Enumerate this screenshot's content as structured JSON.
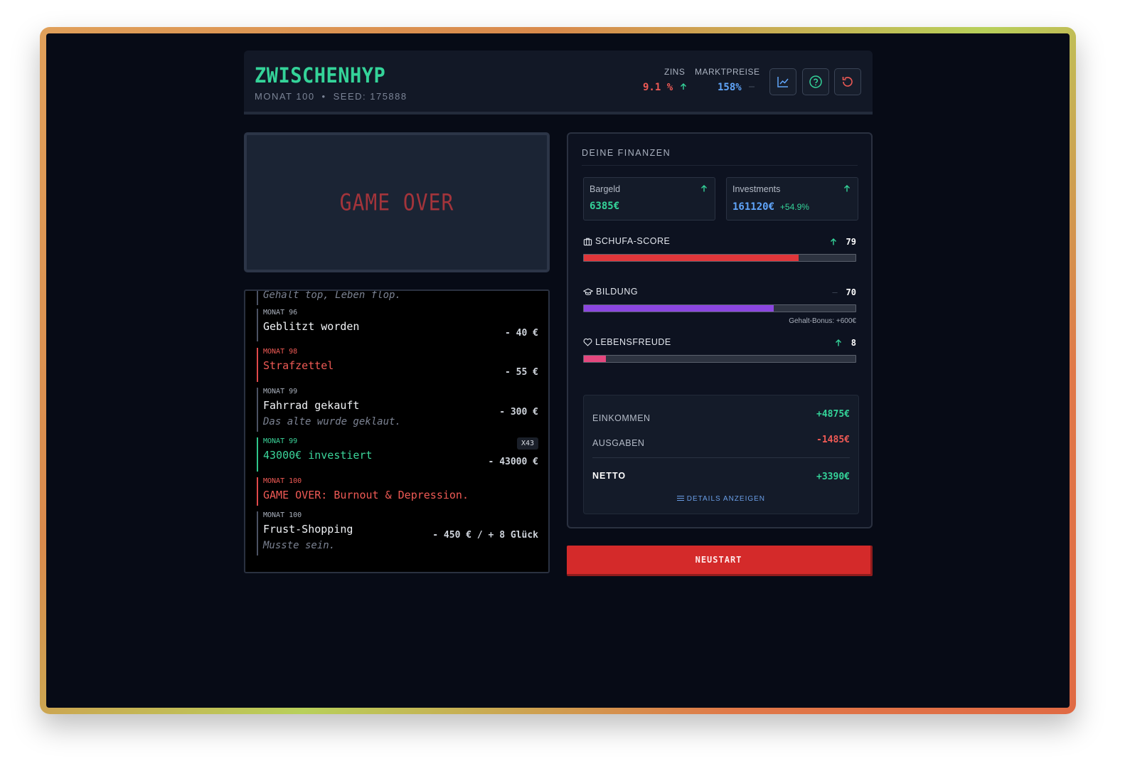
{
  "header": {
    "title": "ZWISCHENHYP",
    "month": "MONAT 100",
    "separator": "•",
    "seed": "SEED: 175888",
    "zins_label": "ZINS",
    "zins_value": "9.1 %",
    "markt_label": "MARKTPREISE",
    "markt_value": "158%",
    "colors": {
      "accent": "#34d399",
      "danger": "#ef5a55",
      "info": "#60a5fa"
    }
  },
  "game_over_text": "GAME OVER",
  "log": [
    {
      "month": "",
      "title": "",
      "desc": "Gehalt top, Leben flop.",
      "amount": ""
    },
    {
      "month": "MONAT 96",
      "title": "Geblitzt worden",
      "desc": "",
      "amount": "- 40 €",
      "type": "normal"
    },
    {
      "month": "MONAT 98",
      "title": "Strafzettel",
      "desc": "",
      "amount": "- 55 €",
      "type": "red"
    },
    {
      "month": "MONAT 99",
      "title": "Fahrrad gekauft",
      "desc": "Das alte wurde geklaut.",
      "amount": "- 300 €",
      "type": "normal"
    },
    {
      "month": "MONAT 99",
      "title": "43000€ investiert",
      "desc": "",
      "amount": "- 43000 €",
      "badge": "X43",
      "type": "green"
    },
    {
      "month": "MONAT 100",
      "title": "GAME OVER: Burnout & Depression.",
      "desc": "",
      "amount": "",
      "type": "red"
    },
    {
      "month": "MONAT 100",
      "title": "Frust-Shopping",
      "desc": "Musste sein.",
      "amount": "- 450 € / + 8 Glück",
      "type": "normal"
    }
  ],
  "finance": {
    "title": "DEINE FINANZEN",
    "bargeld_label": "Bargeld",
    "bargeld_value": "6385€",
    "invest_label": "Investments",
    "invest_value": "161120€",
    "invest_change": "+54.9%",
    "schufa_label": "SCHUFA-SCORE",
    "schufa_value": "79",
    "schufa_fill": 0.79,
    "bildung_label": "BILDUNG",
    "bildung_value": "70",
    "bildung_fill": 0.7,
    "bildung_trend": "—",
    "gehalt_bonus": "Gehalt-Bonus: +600€",
    "lebensfreude_label": "LEBENSFREUDE",
    "lebensfreude_value": "8",
    "lebensfreude_fill": 0.08,
    "einkommen_label": "EINKOMMEN",
    "einkommen_value": "+4875€",
    "ausgaben_label": "AUSGABEN",
    "ausgaben_value": "-1485€",
    "netto_label": "NETTO",
    "netto_value": "+3390€",
    "details_label": "DETAILS ANZEIGEN"
  },
  "restart_label": "NEUSTART"
}
